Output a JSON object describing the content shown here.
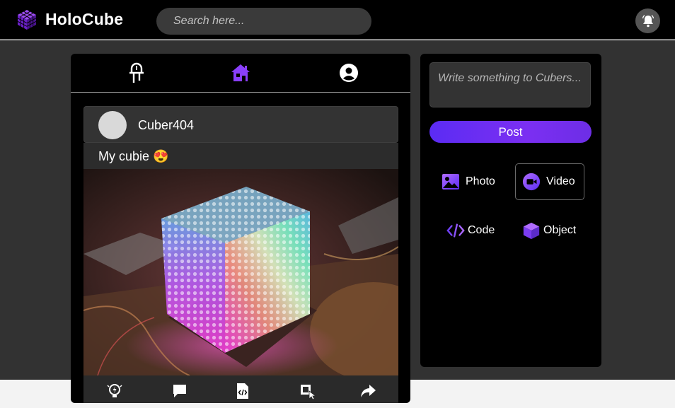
{
  "app": {
    "name": "HoloCube",
    "brand_color": "#7b2ff2"
  },
  "search": {
    "placeholder": "Search here..."
  },
  "header": {
    "bell_icon": "bell-icon"
  },
  "feed_nav": {
    "items": [
      {
        "name": "circuit",
        "icon": "led-icon"
      },
      {
        "name": "home",
        "icon": "home-icon",
        "active": true
      },
      {
        "name": "profile",
        "icon": "user-circle-icon"
      }
    ]
  },
  "post": {
    "username": "Cuber404",
    "caption": "My cubie 😍",
    "image_alt": "LED cube",
    "actions": [
      {
        "name": "idea",
        "icon": "lightbulb-icon"
      },
      {
        "name": "comment",
        "icon": "comment-icon"
      },
      {
        "name": "code",
        "icon": "code-file-icon"
      },
      {
        "name": "open",
        "icon": "cube-select-icon"
      },
      {
        "name": "share",
        "icon": "share-icon"
      }
    ]
  },
  "composer": {
    "placeholder": "Write something to Cubers...",
    "post_label": "Post",
    "options": [
      {
        "label": "Photo",
        "icon": "image-icon"
      },
      {
        "label": "Video",
        "icon": "video-icon",
        "selected": true
      },
      {
        "label": "Code",
        "icon": "code-icon"
      },
      {
        "label": "Object",
        "icon": "cube-icon"
      }
    ]
  }
}
